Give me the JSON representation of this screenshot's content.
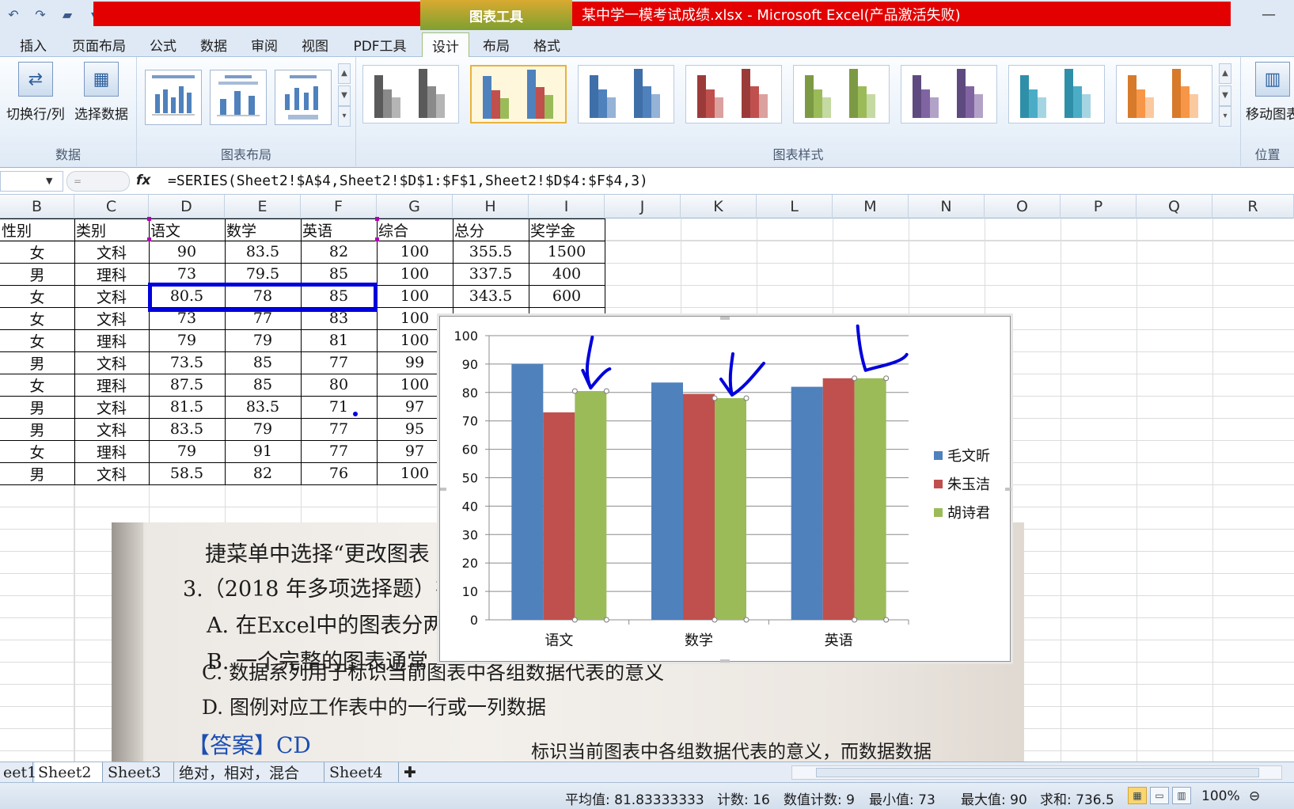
{
  "title_bar": {
    "context_tool": "图表工具",
    "window_title": "某中学一模考试成绩.xlsx - Microsoft Excel(产品激活失败)",
    "qat": [
      "undo-icon",
      "redo-icon",
      "open-folder-icon",
      "customize-icon"
    ]
  },
  "tabs": [
    "插入",
    "页面布局",
    "公式",
    "数据",
    "审阅",
    "视图",
    "PDF工具",
    "设计",
    "布局",
    "格式"
  ],
  "active_tab": "设计",
  "ribbon": {
    "groups": {
      "data": "数据",
      "chart_layout": "图表布局",
      "chart_styles": "图表样式",
      "location": "位置"
    },
    "buttons": {
      "switch_row_col": "切换行/列",
      "select_data": "选择数据",
      "move_chart": "移动图表"
    },
    "style_colors": [
      "#5a5a5a",
      "#4f81bd",
      "#4f81bd",
      "#c0504d",
      "#9bbb59",
      "#8064a2",
      "#4bacc6",
      "#f79646"
    ]
  },
  "formula_bar": {
    "fx": "fx",
    "formula": "=SERIES(Sheet2!$A$4,Sheet2!$D$1:$F$1,Sheet2!$D$4:$F$4,3)"
  },
  "columns": [
    "B",
    "C",
    "D",
    "E",
    "F",
    "G",
    "H",
    "I",
    "J",
    "K",
    "L",
    "M",
    "N",
    "O",
    "P",
    "Q",
    "R"
  ],
  "table": {
    "headers": [
      "性别",
      "类别",
      "语文",
      "数学",
      "英语",
      "综合",
      "总分",
      "奖学金"
    ],
    "rows": [
      [
        "女",
        "文科",
        "90",
        "83.5",
        "82",
        "100",
        "355.5",
        "1500"
      ],
      [
        "男",
        "理科",
        "73",
        "79.5",
        "85",
        "100",
        "337.5",
        "400"
      ],
      [
        "女",
        "文科",
        "80.5",
        "78",
        "85",
        "100",
        "343.5",
        "600"
      ],
      [
        "女",
        "文科",
        "73",
        "77",
        "83",
        "100",
        "",
        ""
      ],
      [
        "女",
        "理科",
        "79",
        "79",
        "81",
        "100",
        "",
        ""
      ],
      [
        "男",
        "文科",
        "73.5",
        "85",
        "77",
        "99",
        "",
        ""
      ],
      [
        "女",
        "理科",
        "87.5",
        "85",
        "80",
        "100",
        "",
        ""
      ],
      [
        "男",
        "文科",
        "81.5",
        "83.5",
        "71",
        "97",
        "",
        ""
      ],
      [
        "男",
        "文科",
        "83.5",
        "79",
        "77",
        "95",
        "",
        ""
      ],
      [
        "女",
        "理科",
        "79",
        "91",
        "77",
        "97",
        "",
        ""
      ],
      [
        "男",
        "文科",
        "58.5",
        "82",
        "76",
        "100",
        "",
        ""
      ]
    ]
  },
  "photo": {
    "lines": [
      "捷菜单中选择“更改图表",
      "3.（2018 年多项选择题）在",
      "A. 在Excel中的图表分两",
      "B. 一个完整的图表通常",
      "C. 数据系列用于标识当前图表中各组数据代表的意义",
      "D. 图例对应工作表中的一行或一列数据",
      "【答案】CD",
      "标识当前图表中各组数据代表的意义，而数据数据"
    ]
  },
  "chart_data": {
    "type": "bar",
    "categories": [
      "语文",
      "数学",
      "英语"
    ],
    "series": [
      {
        "name": "毛文昕",
        "values": [
          90,
          83.5,
          82
        ],
        "color": "#4f81bd"
      },
      {
        "name": "朱玉洁",
        "values": [
          73,
          79.5,
          85
        ],
        "color": "#c0504d"
      },
      {
        "name": "胡诗君",
        "values": [
          80.5,
          78,
          85
        ],
        "color": "#9bbb59"
      }
    ],
    "ylim": [
      0,
      100
    ],
    "yticks": [
      0,
      10,
      20,
      30,
      40,
      50,
      60,
      70,
      80,
      90,
      100
    ],
    "grid": true,
    "legend": "right",
    "title": "",
    "xlabel": "",
    "ylabel": "",
    "selected_series": "胡诗君",
    "annotation_color": "#0000dd"
  },
  "sheet_tabs": [
    "eet1",
    "Sheet2",
    "Sheet3",
    "绝对，相对，混合",
    "Sheet4"
  ],
  "active_sheet": "Sheet2",
  "status_bar": {
    "average": "平均值: 81.83333333",
    "count": "计数: 16",
    "numeric_count": "数值计数: 9",
    "min": "最小值: 73",
    "max": "最大值: 90",
    "sum": "求和: 736.5",
    "zoom": "100%"
  }
}
